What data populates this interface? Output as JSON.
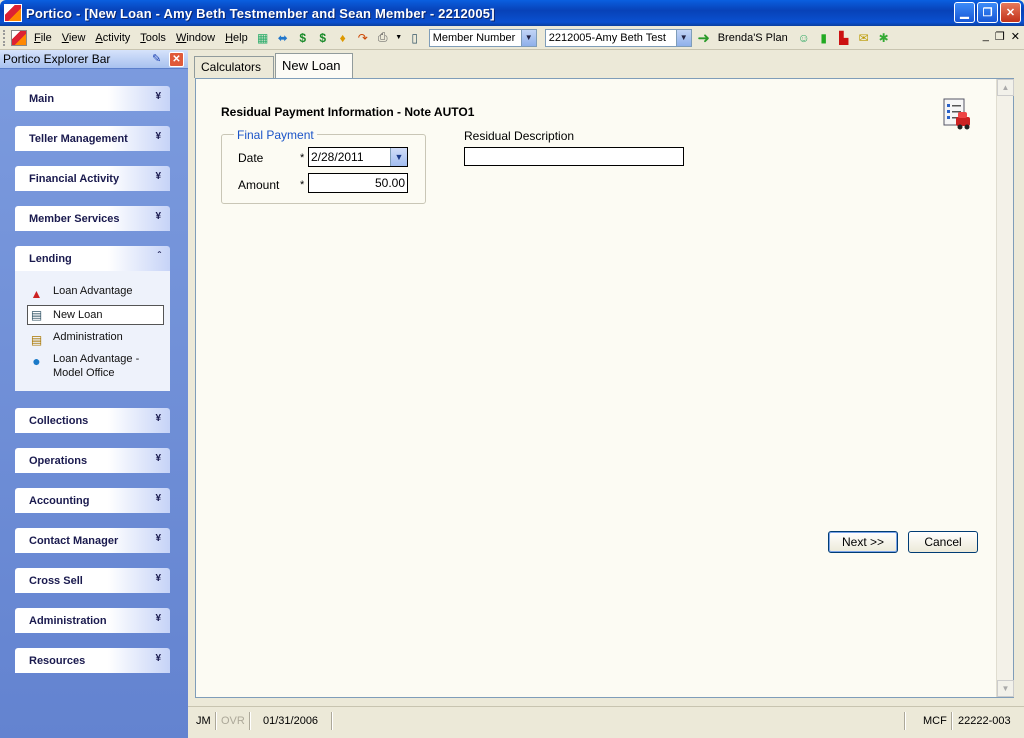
{
  "window": {
    "title": "Portico - [New Loan - Amy Beth Testmember and Sean Member - 2212005]"
  },
  "menu": {
    "items": [
      "File",
      "View",
      "Activity",
      "Tools",
      "Window",
      "Help"
    ]
  },
  "toolbar": {
    "search_type": "Member Number",
    "member_select": "2212005-Amy Beth Test",
    "plan_label": "Brenda'S Plan"
  },
  "explorer": {
    "title": "Portico Explorer Bar",
    "groups": {
      "main": "Main",
      "teller": "Teller Management",
      "financial": "Financial Activity",
      "member_services": "Member Services",
      "lending": "Lending",
      "collections": "Collections",
      "operations": "Operations",
      "accounting": "Accounting",
      "contact_manager": "Contact Manager",
      "cross_sell": "Cross Sell",
      "administration": "Administration",
      "resources": "Resources"
    },
    "lending_tasks": {
      "loan_advantage": "Loan Advantage",
      "new_loan": "New Loan",
      "administration": "Administration",
      "model_office": "Loan Advantage - Model Office"
    }
  },
  "tabs": {
    "calculators": "Calculators",
    "new_loan": "New Loan"
  },
  "form": {
    "title": "Residual Payment Information - Note AUTO1",
    "final_payment_legend": "Final Payment",
    "date_label": "Date",
    "date_value": "2/28/2011",
    "amount_label": "Amount",
    "amount_value": "50.00",
    "required_mark": "*",
    "residual_description_label": "Residual Description",
    "residual_description_value": "",
    "next_label": "Next >>",
    "cancel_label": "Cancel"
  },
  "status": {
    "user": "JM",
    "mode": "OVR",
    "date": "01/31/2006",
    "code": "MCF",
    "id": "22222-003"
  }
}
